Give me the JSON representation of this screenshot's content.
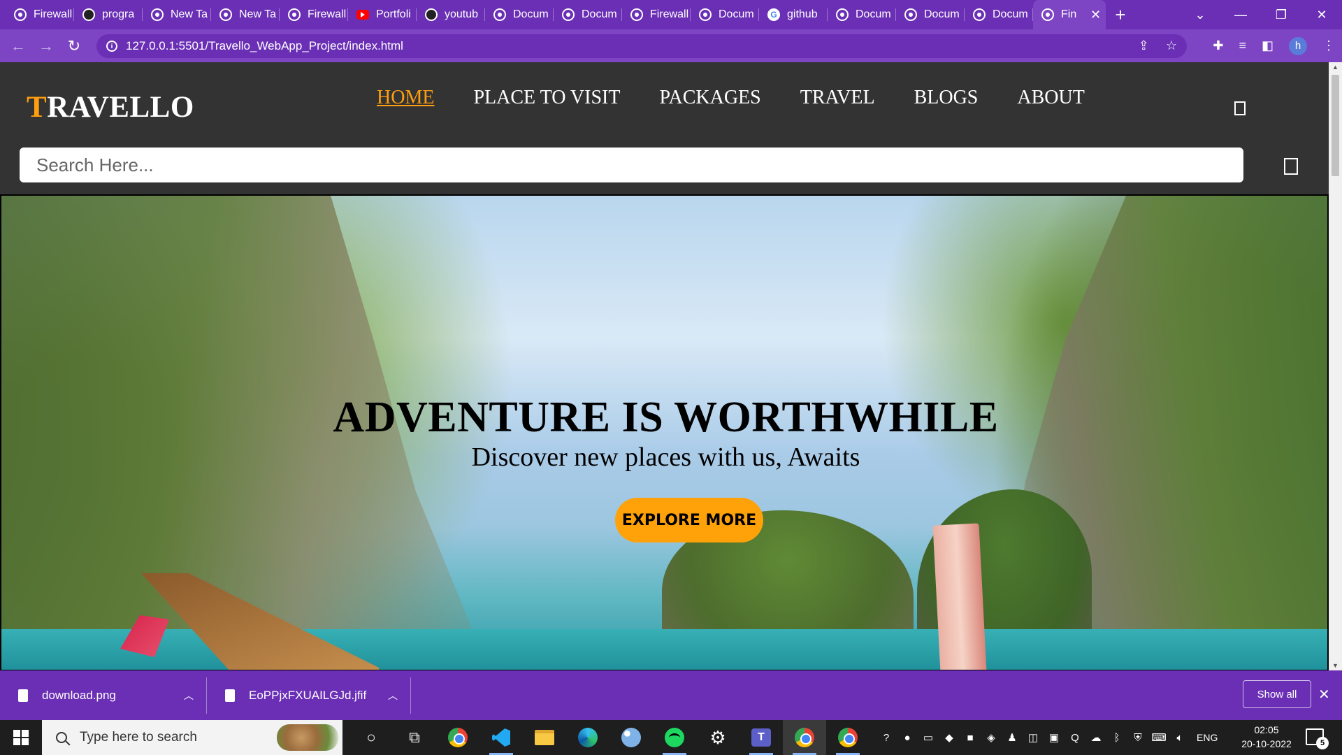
{
  "browser": {
    "tabs": [
      {
        "title": "Firewall",
        "icon": "globe-icon"
      },
      {
        "title": "progra",
        "icon": "github-icon"
      },
      {
        "title": "New Ta",
        "icon": "globe-icon"
      },
      {
        "title": "New Ta",
        "icon": "globe-icon"
      },
      {
        "title": "Firewall",
        "icon": "globe-icon"
      },
      {
        "title": "Portfoli",
        "icon": "youtube-icon"
      },
      {
        "title": "youtub",
        "icon": "github-icon"
      },
      {
        "title": "Docum",
        "icon": "globe-icon"
      },
      {
        "title": "Docum",
        "icon": "globe-icon"
      },
      {
        "title": "Firewall",
        "icon": "globe-icon"
      },
      {
        "title": "Docum",
        "icon": "globe-icon"
      },
      {
        "title": "github",
        "icon": "google-icon"
      },
      {
        "title": "Docum",
        "icon": "globe-icon"
      },
      {
        "title": "Docum",
        "icon": "globe-icon"
      },
      {
        "title": "Docum",
        "icon": "globe-icon"
      },
      {
        "title": "Fin",
        "icon": "globe-icon",
        "active": true
      }
    ],
    "new_tab_glyph": "+",
    "url": "127.0.0.1:5501/Travello_WebApp_Project/index.html",
    "profile_initial": "h",
    "accent_color": "#6a2fb5"
  },
  "site": {
    "brand_first": "T",
    "brand_rest": "RAVELLO",
    "brand_accent": "#ff9f0f",
    "nav": [
      "HOME",
      "PLACE TO VISIT",
      "PACKAGES",
      "TRAVEL",
      "BLOGS",
      "ABOUT"
    ],
    "active_nav": "HOME",
    "search_placeholder": "Search Here...",
    "hero_title": "ADVENTURE IS WORTHWHILE",
    "hero_subtitle": "Discover new places with us, Awaits",
    "hero_button": "EXPLORE MORE"
  },
  "downloads": {
    "items": [
      {
        "name": "download.png"
      },
      {
        "name": "EoPPjxFXUAILGJd.jfif"
      }
    ],
    "show_all_label": "Show all"
  },
  "taskbar": {
    "search_placeholder": "Type here to search",
    "language": "ENG",
    "time": "02:05",
    "date": "20-10-2022",
    "notification_count": "5"
  }
}
